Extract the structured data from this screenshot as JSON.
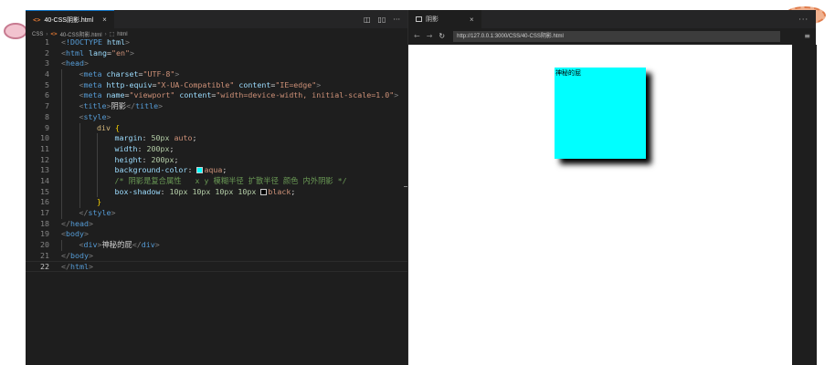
{
  "editor": {
    "tab_title": "40-CSS阴影.html",
    "tab_icon": "<>",
    "tab_close": "×",
    "breadcrumb": [
      "CSS",
      "40-CSS阴影.html",
      "html"
    ],
    "code_lines": [
      {
        "n": "1",
        "indent": 0,
        "tokens": [
          [
            "t-punc",
            "<"
          ],
          [
            "t-tag",
            "!DOCTYPE"
          ],
          [
            "t-text",
            " "
          ],
          [
            "t-attr",
            "html"
          ],
          [
            "t-punc",
            ">"
          ]
        ]
      },
      {
        "n": "2",
        "indent": 0,
        "tokens": [
          [
            "t-punc",
            "<"
          ],
          [
            "t-tag",
            "html"
          ],
          [
            "t-text",
            " "
          ],
          [
            "t-attr",
            "lang"
          ],
          [
            "t-text",
            "="
          ],
          [
            "t-str",
            "\"en\""
          ],
          [
            "t-punc",
            ">"
          ]
        ]
      },
      {
        "n": "3",
        "indent": 0,
        "tokens": [
          [
            "t-punc",
            "<"
          ],
          [
            "t-tag",
            "head"
          ],
          [
            "t-punc",
            ">"
          ]
        ]
      },
      {
        "n": "4",
        "indent": 1,
        "tokens": [
          [
            "t-punc",
            "<"
          ],
          [
            "t-tag",
            "meta"
          ],
          [
            "t-text",
            " "
          ],
          [
            "t-attr",
            "charset"
          ],
          [
            "t-text",
            "="
          ],
          [
            "t-str",
            "\"UTF-8\""
          ],
          [
            "t-punc",
            ">"
          ]
        ]
      },
      {
        "n": "5",
        "indent": 1,
        "tokens": [
          [
            "t-punc",
            "<"
          ],
          [
            "t-tag",
            "meta"
          ],
          [
            "t-text",
            " "
          ],
          [
            "t-attr",
            "http-equiv"
          ],
          [
            "t-text",
            "="
          ],
          [
            "t-str",
            "\"X-UA-Compatible\""
          ],
          [
            "t-text",
            " "
          ],
          [
            "t-attr",
            "content"
          ],
          [
            "t-text",
            "="
          ],
          [
            "t-str",
            "\"IE=edge\""
          ],
          [
            "t-punc",
            ">"
          ]
        ]
      },
      {
        "n": "6",
        "indent": 1,
        "tokens": [
          [
            "t-punc",
            "<"
          ],
          [
            "t-tag",
            "meta"
          ],
          [
            "t-text",
            " "
          ],
          [
            "t-attr",
            "name"
          ],
          [
            "t-text",
            "="
          ],
          [
            "t-str",
            "\"viewport\""
          ],
          [
            "t-text",
            " "
          ],
          [
            "t-attr",
            "content"
          ],
          [
            "t-text",
            "="
          ],
          [
            "t-str",
            "\"width=device-width, initial-scale=1.0\""
          ],
          [
            "t-punc",
            ">"
          ]
        ]
      },
      {
        "n": "7",
        "indent": 1,
        "tokens": [
          [
            "t-punc",
            "<"
          ],
          [
            "t-tag",
            "title"
          ],
          [
            "t-punc",
            ">"
          ],
          [
            "t-text",
            "阴影"
          ],
          [
            "t-punc",
            "</"
          ],
          [
            "t-tag",
            "title"
          ],
          [
            "t-punc",
            ">"
          ]
        ]
      },
      {
        "n": "8",
        "indent": 1,
        "tokens": [
          [
            "t-punc",
            "<"
          ],
          [
            "t-tag",
            "style"
          ],
          [
            "t-punc",
            ">"
          ]
        ]
      },
      {
        "n": "9",
        "indent": 2,
        "tokens": [
          [
            "t-sel",
            "div"
          ],
          [
            "t-text",
            " "
          ],
          [
            "t-brace",
            "{"
          ]
        ]
      },
      {
        "n": "10",
        "indent": 3,
        "tokens": [
          [
            "t-prop",
            "margin"
          ],
          [
            "t-text",
            ": "
          ],
          [
            "t-num",
            "50px"
          ],
          [
            "t-text",
            " "
          ],
          [
            "t-val",
            "auto"
          ],
          [
            "t-text",
            ";"
          ]
        ]
      },
      {
        "n": "11",
        "indent": 3,
        "tokens": [
          [
            "t-prop",
            "width"
          ],
          [
            "t-text",
            ": "
          ],
          [
            "t-num",
            "200px"
          ],
          [
            "t-text",
            ";"
          ]
        ]
      },
      {
        "n": "12",
        "indent": 3,
        "tokens": [
          [
            "t-prop",
            "height"
          ],
          [
            "t-text",
            ": "
          ],
          [
            "t-num",
            "200px"
          ],
          [
            "t-text",
            ";"
          ]
        ]
      },
      {
        "n": "13",
        "indent": 3,
        "tokens": [
          [
            "t-prop",
            "background-color"
          ],
          [
            "t-text",
            ": "
          ],
          [
            "swatch",
            "#00ffff"
          ],
          [
            "t-val",
            "aqua"
          ],
          [
            "t-text",
            ";"
          ]
        ]
      },
      {
        "n": "14",
        "indent": 3,
        "tokens": [
          [
            "t-com",
            "/* 阴影是复合属性   x y 模糊半径 扩散半径 颜色 内外阴影 */"
          ]
        ]
      },
      {
        "n": "15",
        "indent": 3,
        "tokens": [
          [
            "t-prop",
            "box-shadow"
          ],
          [
            "t-text",
            ": "
          ],
          [
            "t-num",
            "10px"
          ],
          [
            "t-text",
            " "
          ],
          [
            "t-num",
            "10px"
          ],
          [
            "t-text",
            " "
          ],
          [
            "t-num",
            "10px"
          ],
          [
            "t-text",
            " "
          ],
          [
            "t-num",
            "10px"
          ],
          [
            "t-text",
            " "
          ],
          [
            "swatch",
            "#000000"
          ],
          [
            "t-val",
            "black"
          ],
          [
            "t-text",
            ";"
          ]
        ]
      },
      {
        "n": "16",
        "indent": 2,
        "tokens": [
          [
            "t-brace",
            "}"
          ]
        ]
      },
      {
        "n": "17",
        "indent": 1,
        "tokens": [
          [
            "t-punc",
            "</"
          ],
          [
            "t-tag",
            "style"
          ],
          [
            "t-punc",
            ">"
          ]
        ]
      },
      {
        "n": "18",
        "indent": 0,
        "tokens": [
          [
            "t-punc",
            "</"
          ],
          [
            "t-tag",
            "head"
          ],
          [
            "t-punc",
            ">"
          ]
        ]
      },
      {
        "n": "19",
        "indent": 0,
        "tokens": [
          [
            "t-punc",
            "<"
          ],
          [
            "t-tag",
            "body"
          ],
          [
            "t-punc",
            ">"
          ]
        ]
      },
      {
        "n": "20",
        "indent": 1,
        "tokens": [
          [
            "t-punc",
            "<"
          ],
          [
            "t-tag",
            "div"
          ],
          [
            "t-punc",
            ">"
          ],
          [
            "t-text",
            "神秘的屁"
          ],
          [
            "t-punc",
            "</"
          ],
          [
            "t-tag",
            "div"
          ],
          [
            "t-punc",
            ">"
          ]
        ]
      },
      {
        "n": "21",
        "indent": 0,
        "tokens": [
          [
            "t-punc",
            "</"
          ],
          [
            "t-tag",
            "body"
          ],
          [
            "t-punc",
            ">"
          ]
        ]
      },
      {
        "n": "22",
        "indent": 0,
        "tokens": [
          [
            "t-punc",
            "</"
          ],
          [
            "t-tag",
            "html"
          ],
          [
            "t-punc",
            ">"
          ]
        ]
      }
    ],
    "current_line": "22"
  },
  "browser": {
    "tab_title": "阴影",
    "tab_close": "×",
    "more_label": "···",
    "back_label": "←",
    "forward_label": "→",
    "reload_label": "↻",
    "url": "http://127.0.0.1:3000/CSS/40-CSS阴影.html",
    "menu_label": "≡",
    "demo_text": "神秘的屁",
    "demo_color": "#00ffff"
  },
  "colors": {
    "editor_bg": "#1e1e1e",
    "tab_accent": "#0e70c0"
  }
}
